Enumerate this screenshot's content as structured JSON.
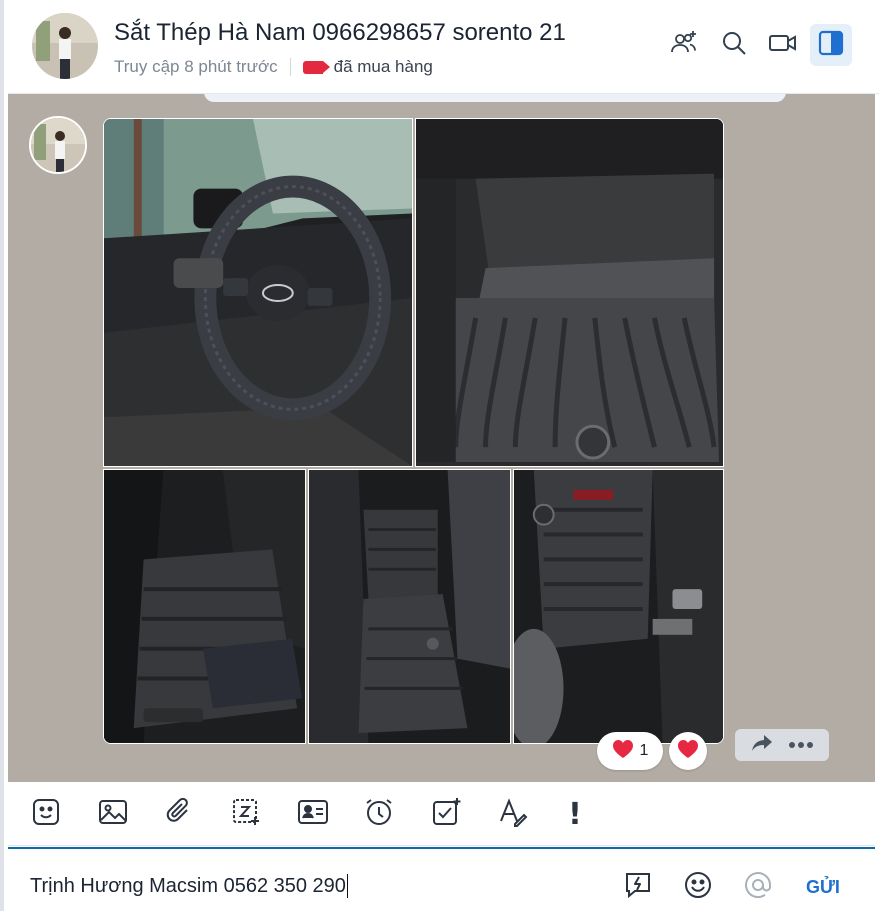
{
  "header": {
    "name": "Sắt Thép Hà Nam 0966298657 sorento 21",
    "last_seen": "Truy cập 8 phút trước",
    "tag_label": "đã mua hàng",
    "tag_color": "#e2293f",
    "icons": [
      "add-member-icon",
      "search-icon",
      "video-call-icon",
      "sidebar-toggle-icon"
    ]
  },
  "message": {
    "photos": [
      {
        "name": "car-interior-steering-wheel"
      },
      {
        "name": "floor-mat-front"
      },
      {
        "name": "floor-mat-rear"
      },
      {
        "name": "floor-mat-middle"
      },
      {
        "name": "floor-mat-driver"
      }
    ],
    "reactions": [
      {
        "icon": "heart-icon",
        "count": "1"
      },
      {
        "icon": "heart-icon"
      }
    ],
    "actions": [
      "share-icon",
      "more-icon"
    ]
  },
  "toolbar": {
    "icons": [
      "sticker-icon",
      "image-icon",
      "attachment-icon",
      "screenshot-icon",
      "contact-card-icon",
      "reminder-icon",
      "todo-icon",
      "text-format-icon",
      "important-icon"
    ],
    "important_glyph": "!"
  },
  "composer": {
    "value": "Trịnh Hương Macsim 0562 350 290",
    "send_label": "GỬI",
    "icons": [
      "quick-message-icon",
      "emoji-icon",
      "mention-icon"
    ]
  }
}
